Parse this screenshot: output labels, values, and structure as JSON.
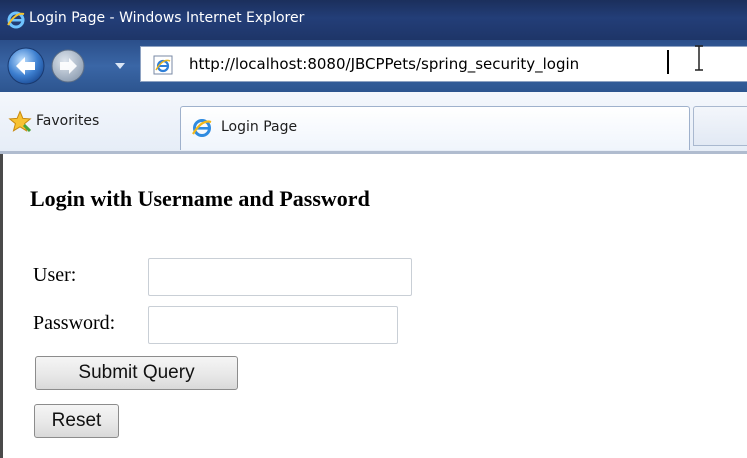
{
  "window": {
    "title": "Login Page - Windows Internet Explorer",
    "title_icon": "ie-logo-icon"
  },
  "navigation": {
    "back_icon": "back-arrow-icon",
    "forward_icon": "forward-arrow-icon",
    "dropdown_icon": "chevron-down-icon",
    "address": {
      "page_icon": "ie-page-icon",
      "url": "http://localhost:8080/JBCPPets/spring_security_login"
    }
  },
  "favorites_bar": {
    "favorites_label": "Favorites",
    "favorites_icon": "star-icon",
    "tabs": [
      {
        "label": "Login Page",
        "icon": "ie-logo-icon",
        "active": true
      }
    ]
  },
  "page": {
    "heading": "Login with Username and Password",
    "form": {
      "user_label": "User:",
      "user_value": "",
      "password_label": "Password:",
      "password_value": "",
      "submit_label": "Submit Query",
      "reset_label": "Reset"
    }
  },
  "colors": {
    "title_bar": "#1e3568",
    "nav_bar": "#3a66a6",
    "favorites_bar": "#e6edf7"
  }
}
